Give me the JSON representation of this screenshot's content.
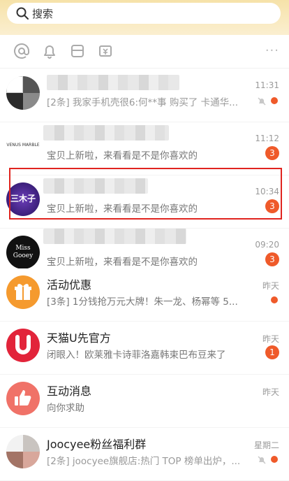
{
  "search": {
    "placeholder": "搜索"
  },
  "colors": {
    "accent": "#ef5a2a",
    "header_bg": "#f6e2a9",
    "highlight": "#e0241f"
  },
  "shortcuts": [
    {
      "icon": "at-icon"
    },
    {
      "icon": "bell-icon"
    },
    {
      "icon": "box-icon"
    },
    {
      "icon": "ticket-icon"
    }
  ],
  "more_label": "···",
  "conversations": [
    {
      "title": "",
      "preview": "[2条] 我家手机壳很6:何**事 购买了 卡通华...",
      "time": "11:31",
      "muted": true,
      "dot": true
    },
    {
      "title": "",
      "avatar_label": "VENUS MARBLE",
      "preview": "宝贝上新啦，来看看是不是你喜欢的",
      "time": "11:12",
      "badge": "3"
    },
    {
      "title": "",
      "avatar_label": "三木子",
      "preview": "宝贝上新啦，来看看是不是你喜欢的",
      "time": "10:34",
      "badge": "3",
      "highlighted": true
    },
    {
      "title": "",
      "avatar_label": "Miss Gooey",
      "preview": "宝贝上新啦，来看看是不是你喜欢的",
      "time": "09:20",
      "badge": "3"
    },
    {
      "title": "活动优惠",
      "preview": "[3条] 1分钱抢万元大牌！朱一龙、杨幂等 5...",
      "time": "昨天",
      "dot": true
    },
    {
      "title": "天猫U先官方",
      "preview": "闭眼入！欧莱雅卡诗菲洛嘉韩束巴布豆来了",
      "time": "昨天",
      "badge": "1"
    },
    {
      "title": "互动消息",
      "preview": "向你求助",
      "time": "昨天"
    },
    {
      "title": "Joocyee粉丝福利群",
      "preview": "[2条] joocyee旗舰店:热门 TOP 榜单出炉，...",
      "time": "星期二",
      "muted": true,
      "dot": true
    }
  ]
}
